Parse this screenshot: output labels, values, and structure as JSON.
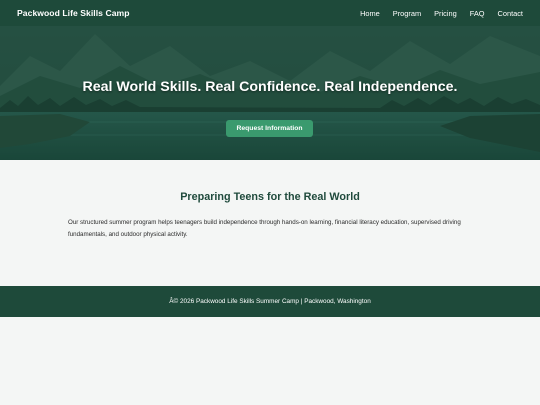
{
  "nav": {
    "brand": "Packwood Life Skills Camp",
    "links": [
      "Home",
      "Program",
      "Pricing",
      "FAQ",
      "Contact"
    ]
  },
  "hero": {
    "title": "Real World Skills. Real Confidence. Real Independence.",
    "cta_label": "Request Information",
    "image_icon": "mountain-lake-photo"
  },
  "intro": {
    "heading": "Preparing Teens for the Real World",
    "body": "Our structured summer program helps teenagers build independence through hands-on learning, financial literacy education, supervised driving fundamentals, and outdoor physical activity."
  },
  "footer": {
    "text": "Â© 2026 Packwood Life Skills Summer Camp | Packwood, Washington"
  },
  "colors": {
    "nav_bg": "#1e4a3a",
    "accent": "#3a9a6e",
    "heading": "#1f4a3c",
    "page_bg": "#f4f6f5"
  }
}
